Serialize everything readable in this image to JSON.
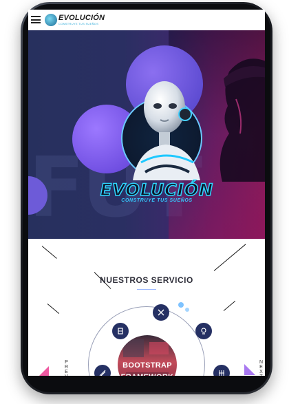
{
  "app": {
    "logo_title": "EVOLUCIÓN",
    "logo_subtitle": "CONSTRUYE TUS SUEÑOS"
  },
  "hero": {
    "bg_letters": "FUT",
    "title": "EVOLUCIÓN",
    "subtitle": "CONSTRUYE TUS SUEÑOS"
  },
  "services": {
    "title": "NUESTROS SERVICIO",
    "center_label": "BOOTSTRAP FRAMEWORK",
    "prev_label": "PREV",
    "next_label": "NEXT",
    "nodes": [
      {
        "icon": "wordpress-icon"
      },
      {
        "icon": "bitcoin-icon"
      },
      {
        "icon": "lightning-icon"
      },
      {
        "icon": "layout-icon"
      },
      {
        "icon": "code-icon"
      },
      {
        "icon": "tag-icon"
      }
    ]
  },
  "colors": {
    "hero_left": "#27305e",
    "hero_right": "#8e1c5c",
    "accent_purple": "#6d5bd8",
    "accent_cyan": "#35c9ff",
    "node_navy": "#253063"
  }
}
